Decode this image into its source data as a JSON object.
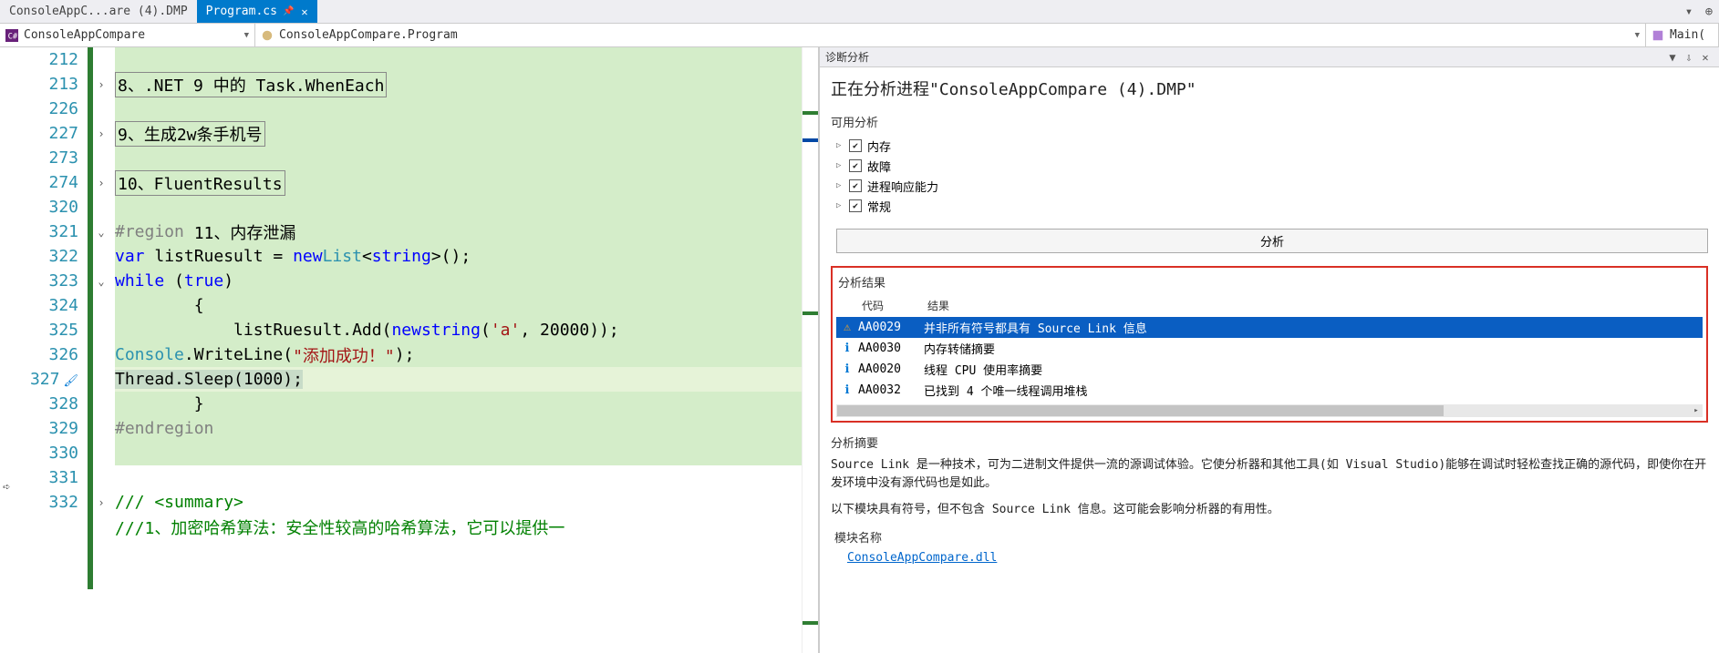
{
  "tabs": {
    "inactive_label": "ConsoleAppC...are (4).DMP",
    "active_label": "Program.cs"
  },
  "context": {
    "project": "ConsoleAppCompare",
    "class": "ConsoleAppCompare.Program",
    "method": "Main("
  },
  "editor": {
    "lines": [
      {
        "num": "212",
        "fold": "",
        "bg": "g",
        "html": ""
      },
      {
        "num": "213",
        "fold": ">",
        "bg": "g",
        "html": "        <span class='box-outline'>8、.NET 9 中的 Task.WhenEach</span>"
      },
      {
        "num": "226",
        "fold": "",
        "bg": "g",
        "html": ""
      },
      {
        "num": "227",
        "fold": ">",
        "bg": "g",
        "html": "        <span class='box-outline'>9、生成2w条手机号</span>"
      },
      {
        "num": "273",
        "fold": "",
        "bg": "g",
        "html": ""
      },
      {
        "num": "274",
        "fold": ">",
        "bg": "g",
        "html": "        <span class='box-outline'>10、FluentResults</span>"
      },
      {
        "num": "320",
        "fold": "",
        "bg": "g",
        "html": ""
      },
      {
        "num": "321",
        "fold": "v",
        "bg": "g",
        "html": "        <span class='region'>#region</span> 11、内存泄漏"
      },
      {
        "num": "322",
        "fold": "",
        "bg": "g",
        "html": "        <span class='kw'>var</span> listRuesult = <span class='kw'>new</span> <span class='type'>List</span>&lt;<span class='kw'>string</span>&gt;();"
      },
      {
        "num": "323",
        "fold": "v",
        "bg": "g",
        "html": "        <span class='kw'>while</span> (<span class='kw'>true</span>)"
      },
      {
        "num": "324",
        "fold": "",
        "bg": "g",
        "html": "        {"
      },
      {
        "num": "325",
        "fold": "",
        "bg": "g",
        "html": "            listRuesult.Add(<span class='kw'>new</span> <span class='kw'>string</span>(<span class='str'>'a'</span>, 20000));"
      },
      {
        "num": "326",
        "fold": "",
        "bg": "g",
        "html": "            <span class='type'>Console</span>.WriteLine(<span class='str'>\"添加成功！\"</span>);"
      },
      {
        "num": "327",
        "fold": "",
        "bg": "hl",
        "html": "            <span class='box-hl'>Thread.Sleep(1000);</span>"
      },
      {
        "num": "328",
        "fold": "",
        "bg": "g",
        "html": "        }"
      },
      {
        "num": "329",
        "fold": "",
        "bg": "g",
        "html": "        <span class='region'>#endregion</span>"
      },
      {
        "num": "330",
        "fold": "",
        "bg": "g",
        "html": ""
      },
      {
        "num": "331",
        "fold": "",
        "bg": "",
        "html": ""
      },
      {
        "num": "332",
        "fold": ">",
        "bg": "",
        "html": "        <span class='comment'>/// &lt;summary&gt;</span>"
      },
      {
        "num": "",
        "fold": "",
        "bg": "",
        "html": "        <span class='comment'>///1、加密哈希算法：安全性较高的哈希算法，它可以提供一</span>"
      }
    ],
    "brush_row": 13
  },
  "diag": {
    "title": "诊断分析",
    "heading": "正在分析进程\"ConsoleAppCompare (4).DMP\"",
    "available_label": "可用分析",
    "analyzers": [
      "内存",
      "故障",
      "进程响应能力",
      "常规"
    ],
    "analyze_btn": "分析",
    "results_label": "分析结果",
    "col_code": "代码",
    "col_result": "结果",
    "rows": [
      {
        "icon": "warn",
        "code": "AA0029",
        "text": "并非所有符号都具有 Source Link 信息",
        "sel": true
      },
      {
        "icon": "info",
        "code": "AA0030",
        "text": "内存转储摘要",
        "sel": false
      },
      {
        "icon": "info",
        "code": "AA0020",
        "text": "线程 CPU 使用率摘要",
        "sel": false
      },
      {
        "icon": "info",
        "code": "AA0032",
        "text": "已找到 4 个唯一线程调用堆栈",
        "sel": false
      }
    ],
    "summary_label": "分析摘要",
    "summary_p1": "Source Link 是一种技术，可为二进制文件提供一流的源调试体验。它使分析器和其他工具(如 Visual Studio)能够在调试时轻松查找正确的源代码，即使你在开发环境中没有源代码也是如此。",
    "summary_p2": "以下模块具有符号，但不包含 Source Link 信息。这可能会影响分析器的有用性。",
    "module_hdr": "模块名称",
    "module_link": "ConsoleAppCompare.dll"
  }
}
